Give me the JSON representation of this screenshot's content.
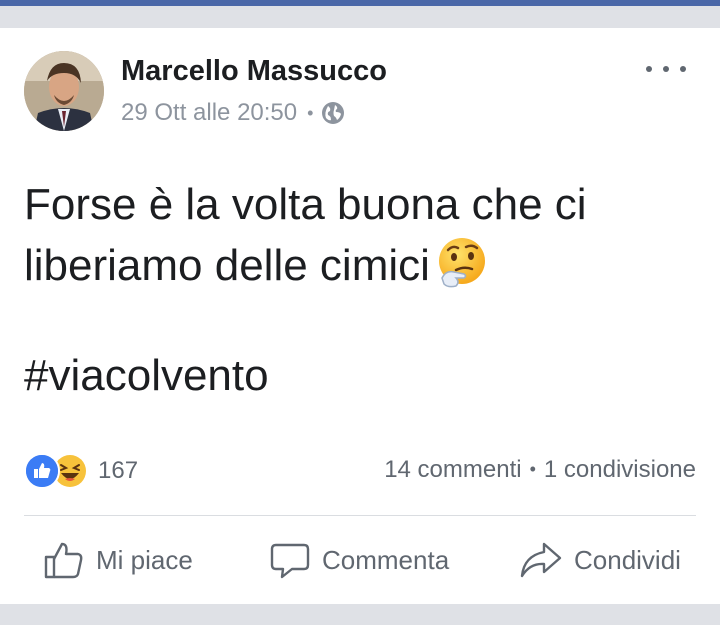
{
  "post": {
    "author": "Marcello Massucco",
    "timestamp": "29 Ott alle 20:50",
    "privacy_icon": "globe-icon",
    "text_line1": "Forse è la volta buona che ci",
    "text_line2": "liberiamo delle cimici",
    "emoji": "thinking-face-emoji",
    "hashtag": "#viacolvento"
  },
  "reactions": {
    "icons": [
      "like-reaction-icon",
      "haha-reaction-icon"
    ],
    "count": "167",
    "comments": "14 commenti",
    "shares": "1 condivisione",
    "separator": "•"
  },
  "actions": {
    "like": "Mi piace",
    "comment": "Commenta",
    "share": "Condividi"
  },
  "colors": {
    "top_bar": "#4a67a8",
    "like_blue": "#3b7cf5",
    "meta_gray": "#8d949e",
    "text": "#1c1e21"
  }
}
